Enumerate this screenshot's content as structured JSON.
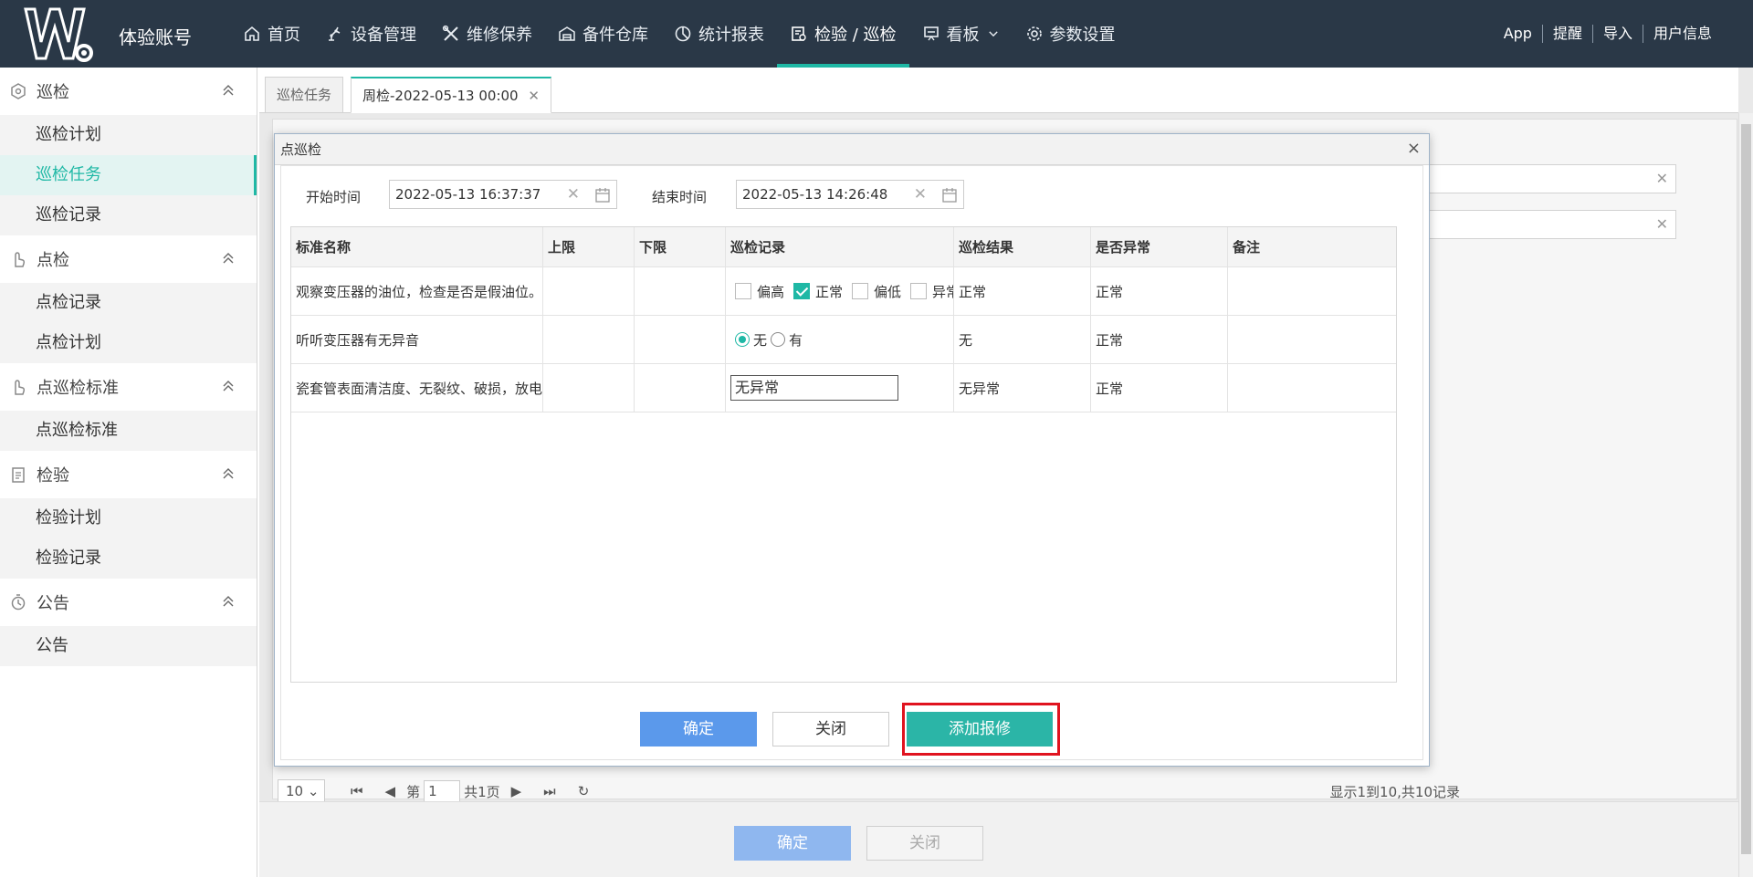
{
  "header": {
    "brand": "体验账号",
    "nav": [
      {
        "label": "首页",
        "icon": "home-icon"
      },
      {
        "label": "设备管理",
        "icon": "robot-arm-icon"
      },
      {
        "label": "维修保养",
        "icon": "tools-icon"
      },
      {
        "label": "备件仓库",
        "icon": "warehouse-icon"
      },
      {
        "label": "统计报表",
        "icon": "pie-chart-icon"
      },
      {
        "label": "检验 / 巡检",
        "icon": "inspection-icon",
        "active": true
      },
      {
        "label": "看板",
        "icon": "board-icon"
      },
      {
        "label": "参数设置",
        "icon": "gear-icon"
      }
    ],
    "right_links": [
      "App",
      "提醒",
      "导入",
      "用户信息"
    ]
  },
  "sidebar": {
    "groups": [
      {
        "label": "巡检",
        "icon": "patrol-icon",
        "items": [
          "巡检计划",
          "巡检任务",
          "巡检记录"
        ]
      },
      {
        "label": "点检",
        "icon": "hand-point-icon",
        "items": [
          "点检记录",
          "点检计划"
        ]
      },
      {
        "label": "点巡检标准",
        "icon": "hand-point-icon",
        "items": [
          "点巡检标准"
        ]
      },
      {
        "label": "检验",
        "icon": "clipboard-icon",
        "items": [
          "检验计划",
          "检验记录"
        ]
      },
      {
        "label": "公告",
        "icon": "timer-icon",
        "items": [
          "公告"
        ]
      }
    ],
    "active_item": "巡检任务"
  },
  "tabs": [
    {
      "label": "巡检任务"
    },
    {
      "label": "周检-2022-05-13 00:00",
      "active": true,
      "close": "✕"
    }
  ],
  "background": {
    "pager": {
      "page_size": "10",
      "page_prefix": "第",
      "page_value": "1",
      "page_suffix": "共1页",
      "info": "显示1到10,共10记录"
    },
    "buttons": {
      "ok": "确定",
      "close": "关闭"
    }
  },
  "dialog": {
    "title": "点巡检",
    "close_glyph": "×",
    "start_label": "开始时间",
    "start_value": "2022-05-13 16:37:37",
    "end_label": "结束时间",
    "end_value": "2022-05-13 14:26:48",
    "columns": [
      "标准名称",
      "上限",
      "下限",
      "巡检记录",
      "巡检结果",
      "是否异常",
      "备注"
    ],
    "rows": [
      {
        "name": "观察变压器的油位，检查是否是假油位。",
        "upper": "",
        "lower": "",
        "type": "checkbox",
        "options": [
          {
            "label": "偏高",
            "checked": false
          },
          {
            "label": "正常",
            "checked": true
          },
          {
            "label": "偏低",
            "checked": false
          },
          {
            "label": "异常",
            "checked": false
          }
        ],
        "result": "正常",
        "abnormal": "正常",
        "remark": ""
      },
      {
        "name": "听听变压器有无异音",
        "upper": "",
        "lower": "",
        "type": "radio",
        "options": [
          {
            "label": "无",
            "checked": true
          },
          {
            "label": "有",
            "checked": false
          }
        ],
        "result": "无",
        "abnormal": "正常",
        "remark": ""
      },
      {
        "name": "瓷套管表面清洁度、无裂纹、破损，放电",
        "upper": "",
        "lower": "",
        "type": "text",
        "value": "无异常",
        "result": "无异常",
        "abnormal": "正常",
        "remark": ""
      }
    ],
    "buttons": {
      "ok": "确定",
      "close": "关闭",
      "add_repair": "添加报修"
    },
    "colors": {
      "accent": "#1fb8a5",
      "primary": "#5b99eb",
      "highlight": "#e0131f"
    }
  }
}
